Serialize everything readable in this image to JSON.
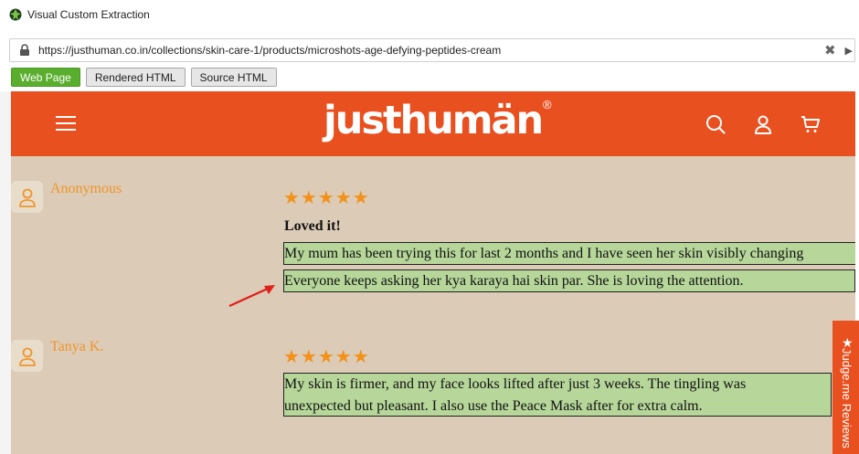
{
  "window": {
    "title": "Visual Custom Extraction"
  },
  "address_bar": {
    "url": "https://justhuman.co.in/collections/skin-care-1/products/microshots-age-defying-peptides-cream",
    "clear_label": "✖",
    "scroll_label": "▶"
  },
  "view_tabs": [
    {
      "label": "Web Page",
      "active": true
    },
    {
      "label": "Rendered HTML",
      "active": false
    },
    {
      "label": "Source HTML",
      "active": false
    }
  ],
  "site": {
    "logo": "justhumän",
    "reg_mark": "®",
    "brand_color": "#e9501f"
  },
  "reviews": [
    {
      "reviewer": "Anonymous",
      "stars": "★★★★★",
      "rating": 5,
      "title": "Loved it!",
      "lines": [
        "My mum has been trying this for last 2 months and I have seen her skin visibly changing",
        "Everyone keeps asking her kya karaya hai skin par. She is loving the attention."
      ]
    },
    {
      "reviewer": "Tanya K.",
      "stars": "★★★★★",
      "rating": 5,
      "title": "",
      "lines": [
        "My skin is firmer, and my face looks lifted after just 3 weeks. The tingling was",
        "unexpected but pleasant. I also use the Peace Mask after for extra calm."
      ]
    }
  ],
  "judgeme_tab": {
    "label": "Judge.me Reviews",
    "star": "★"
  },
  "colors": {
    "highlight": "#b6d69a",
    "star": "#f39119",
    "reviewer": "#f0962a",
    "annotation_arrow": "#e0201a",
    "active_tab": "#5aae2e"
  }
}
